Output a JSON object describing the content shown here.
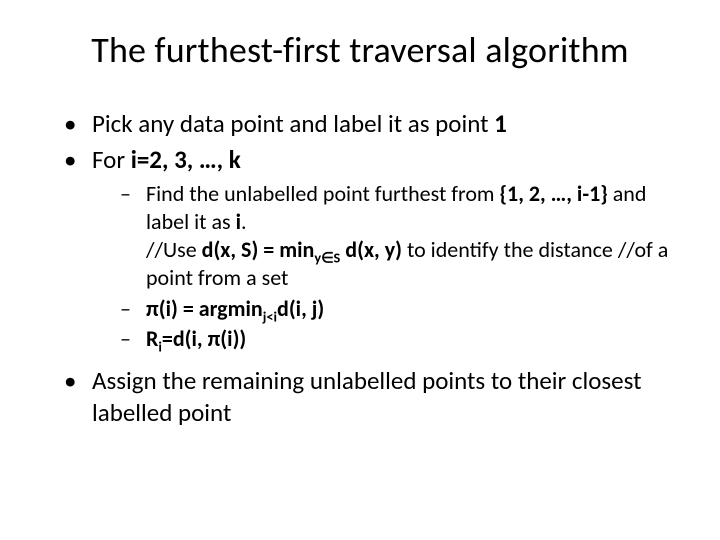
{
  "title": "The furthest-first traversal algorithm",
  "bullets": {
    "b1_pre": "Pick any data point and label it as point ",
    "b1_bold": "1",
    "b2_pre": "For ",
    "b2_bold": "i=2, 3, …, k",
    "sub1_a": "Find the unlabelled point furthest from ",
    "sub1_b": "{1, 2, …, i-1} ",
    "sub1_c": "and label it as ",
    "sub1_d": "i",
    "sub1_e": ".",
    "sub1_line2a": "//Use ",
    "sub1_line2b": "d(x, S) = min",
    "sub1_line2b_sub": "y∈S",
    "sub1_line2c": " d(x, y) ",
    "sub1_line2d": "to identify the distance //of a point from a set",
    "sub2_a": "π(i) = argmin",
    "sub2_sub": "j<i",
    "sub2_b": "d(i, j)",
    "sub3_a": "R",
    "sub3_sub": "i",
    "sub3_b": "=d(i, π(i))",
    "b3": "Assign the remaining unlabelled points to their closest labelled point"
  }
}
